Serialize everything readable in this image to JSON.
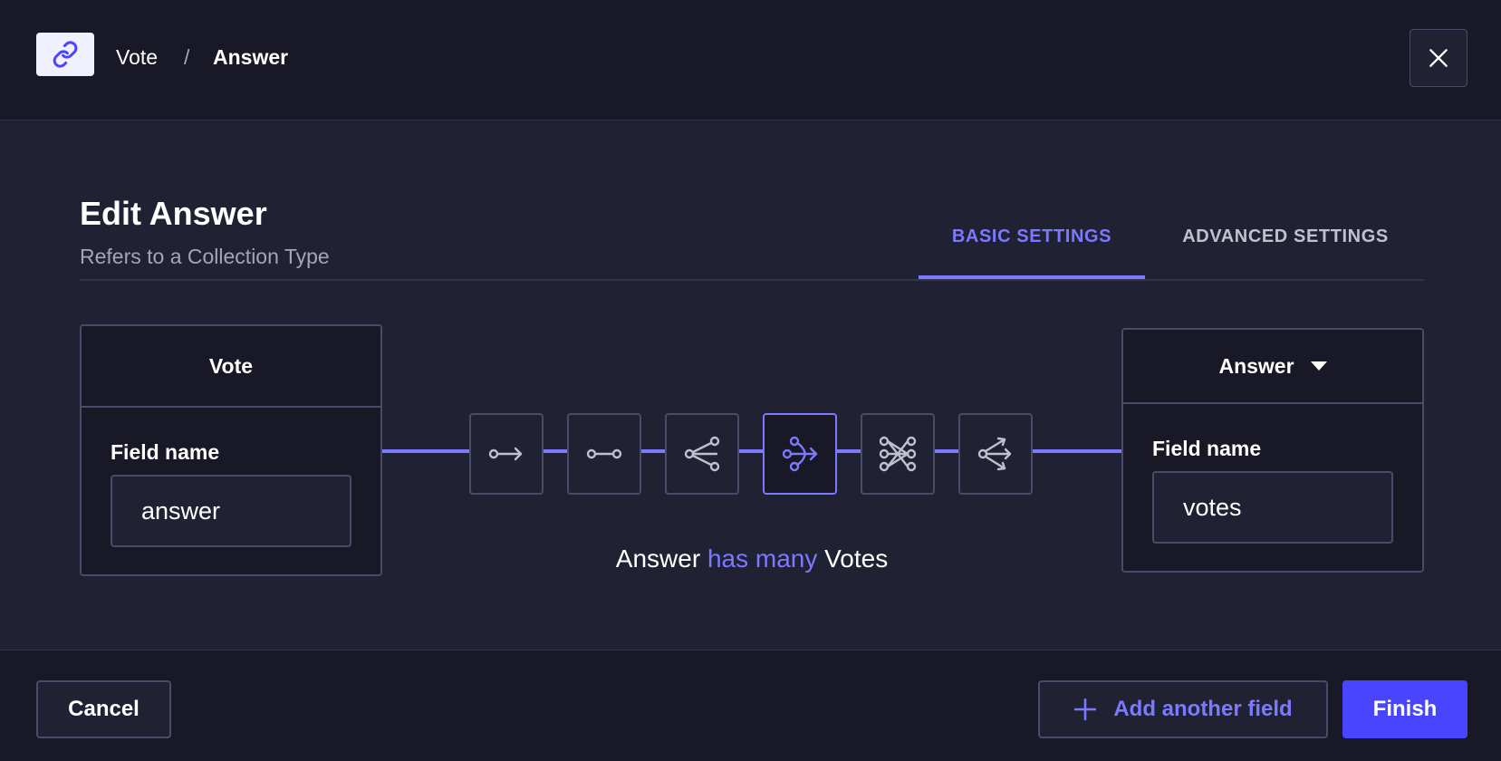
{
  "header": {
    "breadcrumb": [
      "Vote",
      "/",
      "Answer"
    ],
    "icons": {
      "badge": "link-icon",
      "close": "close-icon"
    }
  },
  "main": {
    "title": "Edit Answer",
    "subtitle": "Refers to a Collection Type",
    "tabs": [
      {
        "label": "BASIC SETTINGS",
        "active": true
      },
      {
        "label": "ADVANCED SETTINGS",
        "active": false
      }
    ],
    "left_box": {
      "heading": "Vote",
      "field_label": "Field name",
      "field_value": "answer"
    },
    "right_box": {
      "heading": "Answer",
      "field_label": "Field name",
      "field_value": "votes"
    },
    "relations": [
      {
        "icon": "one-way-relation-icon",
        "active": false
      },
      {
        "icon": "one-to-one-relation-icon",
        "active": false
      },
      {
        "icon": "one-to-many-relation-icon",
        "active": false
      },
      {
        "icon": "many-to-one-relation-icon",
        "active": true
      },
      {
        "icon": "many-to-many-relation-icon",
        "active": false
      },
      {
        "icon": "many-way-relation-icon",
        "active": false
      }
    ],
    "sentence": {
      "left": "Answer",
      "middle": "has many",
      "right": "Votes"
    }
  },
  "footer": {
    "cancel_label": "Cancel",
    "add_label": "Add another field",
    "finish_label": "Finish"
  },
  "colors": {
    "accent": "#7b79ff",
    "primary": "#4945ff",
    "background": "#212134",
    "surface": "#181826",
    "border": "#4a4a6a"
  }
}
